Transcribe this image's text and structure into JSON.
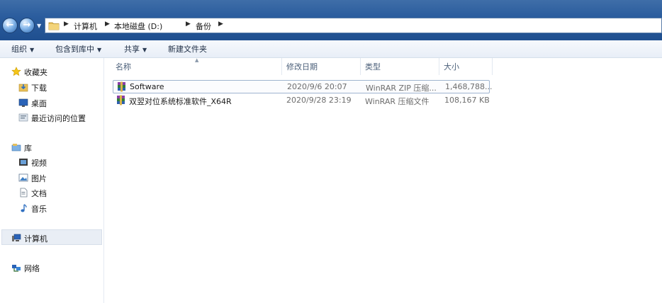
{
  "address": {
    "crumbs": [
      "计算机",
      "本地磁盘 (D:)",
      "备份"
    ]
  },
  "toolbar": {
    "organize": "组织",
    "include_library": "包含到库中",
    "share": "共享",
    "new_folder": "新建文件夹"
  },
  "nav": {
    "favorites": "收藏夹",
    "downloads": "下载",
    "desktop": "桌面",
    "recent": "最近访问的位置",
    "libraries": "库",
    "videos": "视频",
    "pictures": "图片",
    "documents": "文档",
    "music": "音乐",
    "computer": "计算机",
    "network": "网络"
  },
  "columns": {
    "name": "名称",
    "modified": "修改日期",
    "type": "类型",
    "size": "大小"
  },
  "files": [
    {
      "name": "Software",
      "modified": "2020/9/6 20:07",
      "type": "WinRAR ZIP 压缩...",
      "size": "1,468,788...",
      "selected": true
    },
    {
      "name": "双翌对位系统标准软件_X64R",
      "modified": "2020/9/28 23:19",
      "type": "WinRAR 压缩文件",
      "size": "108,167 KB",
      "selected": false
    }
  ],
  "colors": {
    "titlebar": "#2b5d9e",
    "selection_border": "#9fb4cf"
  }
}
